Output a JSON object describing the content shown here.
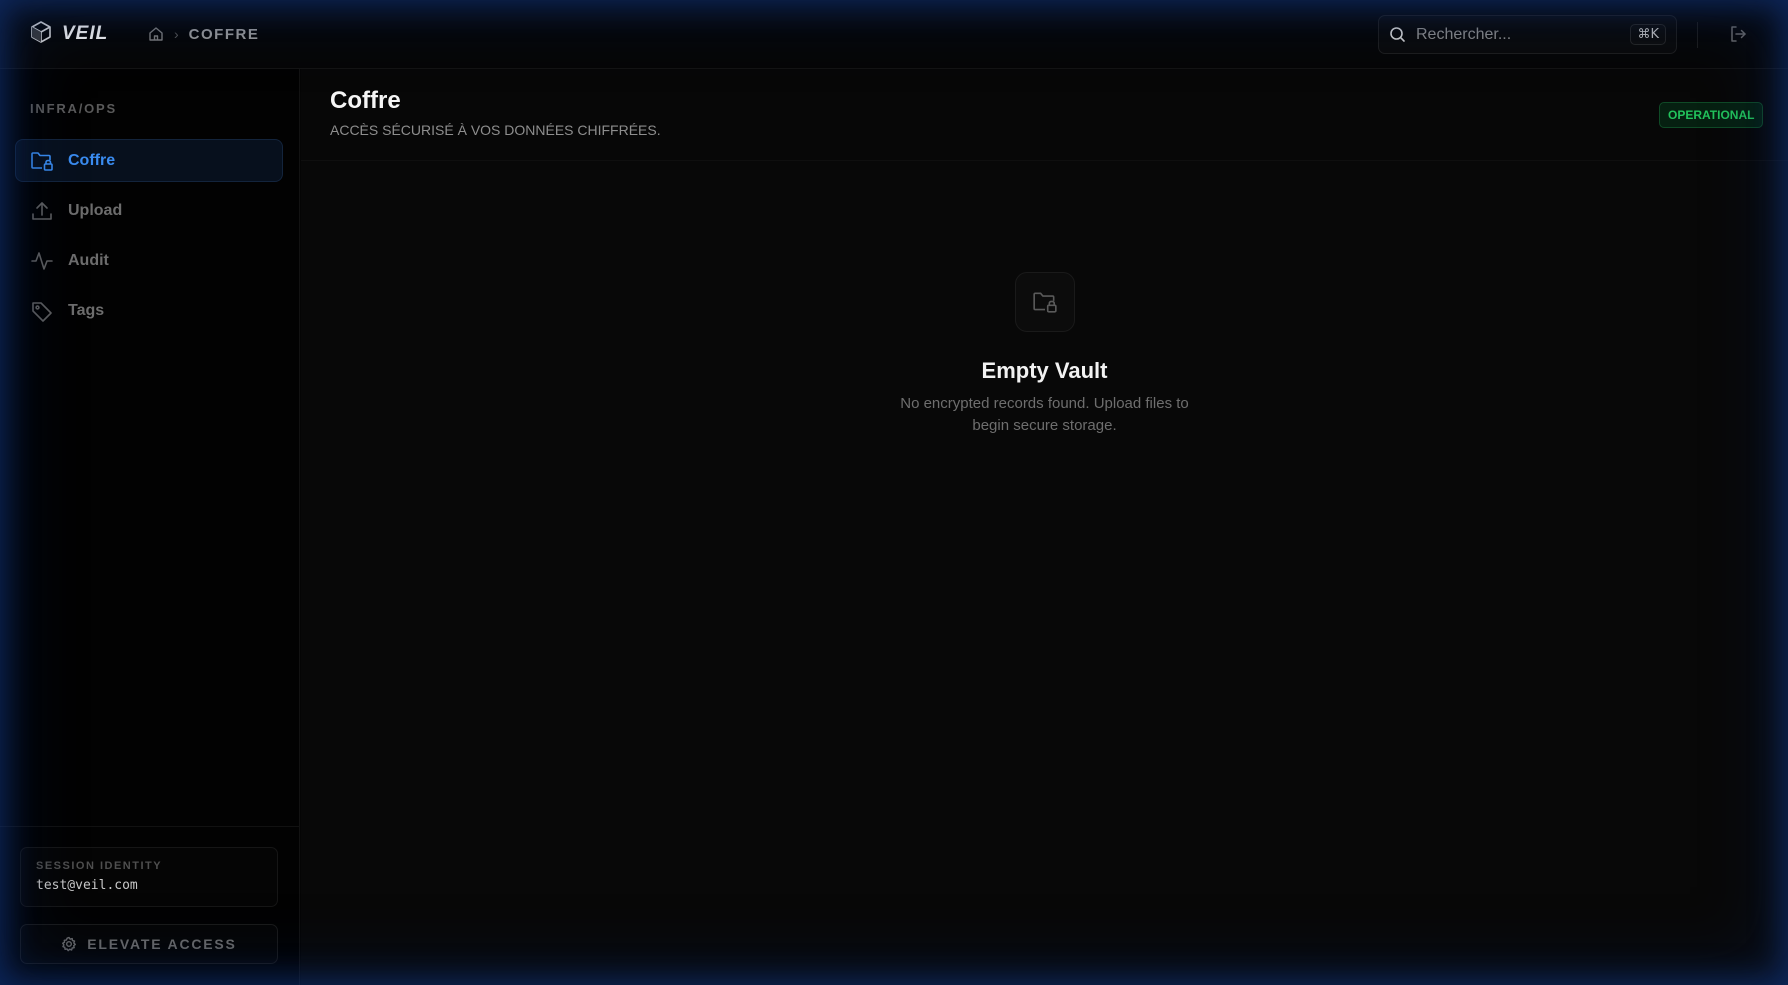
{
  "header": {
    "brand": "VEIL",
    "breadcrumb_current": "COFFRE",
    "search_placeholder": "Rechercher...",
    "search_shortcut": "⌘K"
  },
  "sidebar": {
    "section_label": "INFRA/OPS",
    "items": [
      {
        "label": "Coffre",
        "icon": "folder-lock-icon",
        "active": true
      },
      {
        "label": "Upload",
        "icon": "upload-icon",
        "active": false
      },
      {
        "label": "Audit",
        "icon": "activity-icon",
        "active": false
      },
      {
        "label": "Tags",
        "icon": "tag-icon",
        "active": false
      }
    ],
    "identity_label": "SESSION IDENTITY",
    "identity_value": "test@veil.com",
    "elevate_label": "ELEVATE ACCESS"
  },
  "main": {
    "title": "Coffre",
    "subtitle": "ACCÈS SÉCURISÉ À VOS DONNÉES CHIFFRÉES.",
    "status": "OPERATIONAL",
    "empty_title": "Empty Vault",
    "empty_desc": "No encrypted records found. Upload files to begin secure storage."
  },
  "colors": {
    "accent": "#3a8cf0",
    "status_green": "#22c35c",
    "background": "#050505"
  }
}
